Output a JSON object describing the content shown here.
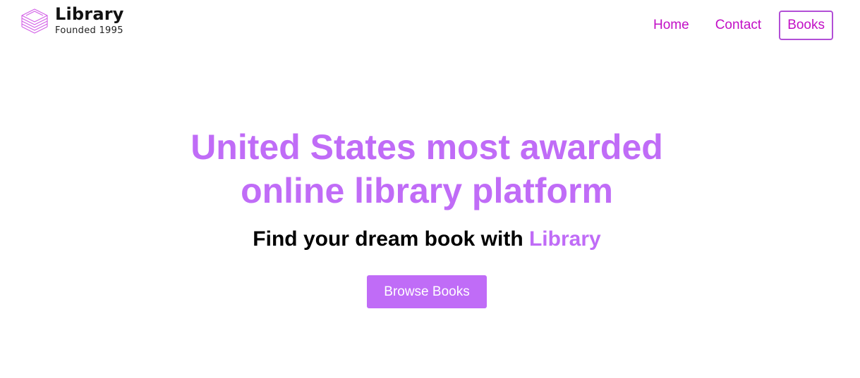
{
  "brand": {
    "name": "Library",
    "tagline": "Founded 1995",
    "logo_icon": "stacked-books-icon"
  },
  "nav": {
    "items": [
      {
        "label": "Home",
        "active": false
      },
      {
        "label": "Contact",
        "active": false
      },
      {
        "label": "Books",
        "active": true
      }
    ]
  },
  "hero": {
    "title_line1": "United States most awarded",
    "title_line2": "online library platform",
    "subtitle_prefix": "Find your dream book with ",
    "subtitle_accent": "Library",
    "cta_label": "Browse Books"
  },
  "colors": {
    "accent": "#c06cf7",
    "nav_link": "#c20fc6",
    "active_border": "#b24fd6",
    "text": "#000000",
    "background": "#ffffff"
  }
}
